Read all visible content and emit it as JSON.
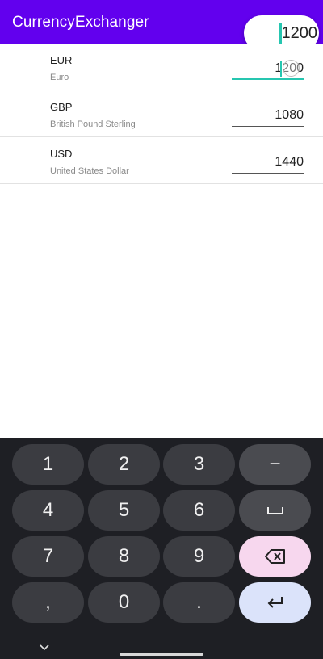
{
  "app": {
    "title": "CurrencyExchanger"
  },
  "magnifier": {
    "value": "1200"
  },
  "currencies": [
    {
      "code": "EUR",
      "name": "Euro",
      "amount": "1200",
      "active": true
    },
    {
      "code": "GBP",
      "name": "British Pound Sterling",
      "amount": "1080",
      "active": false
    },
    {
      "code": "USD",
      "name": "United States Dollar",
      "amount": "1440",
      "active": false
    }
  ],
  "keyboard": {
    "keys": [
      [
        "1",
        "2",
        "3",
        "−"
      ],
      [
        "4",
        "5",
        "6",
        "space-icon"
      ],
      [
        "7",
        "8",
        "9",
        "backspace-icon"
      ],
      [
        ",",
        "0",
        ".",
        "enter-icon"
      ]
    ]
  },
  "colors": {
    "appbar": "#6200ee",
    "accent": "#26c6b0",
    "keyboard_bg": "#1e1f24",
    "key_bg": "#3b3c41",
    "delete_key_bg": "#f7d7ee",
    "enter_key_bg": "#dbe3fa"
  }
}
